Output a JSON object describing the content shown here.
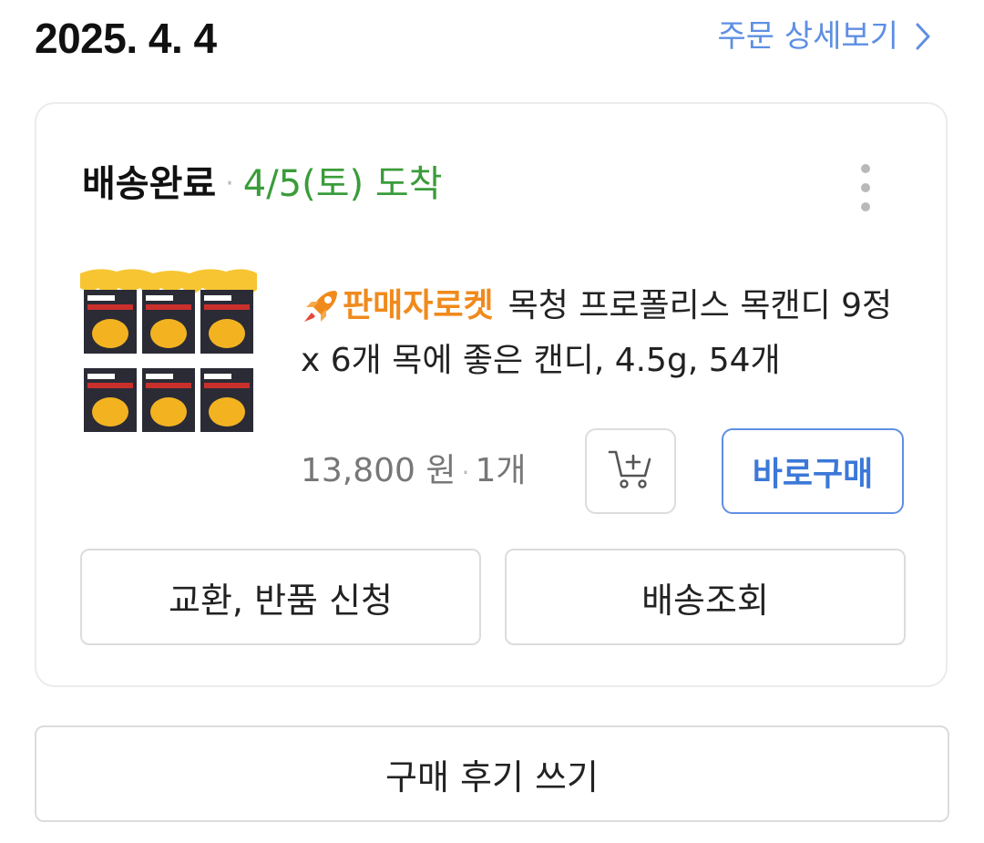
{
  "order": {
    "date": "2025. 4. 4",
    "detail_link_label": "주문 상세보기"
  },
  "card": {
    "status": "배송완료",
    "separator": "·",
    "arrival": "4/5(토) 도착"
  },
  "product": {
    "badge": "판매자로켓",
    "title": "목청 프로폴리스 목캔디 9정 x 6개 목에 좋은 캔디, 4.5g, 54개",
    "price": "13,800 원",
    "price_separator": "·",
    "quantity": "1개"
  },
  "buttons": {
    "buy_now": "바로구매",
    "exchange_return": "교환, 반품 신청",
    "track_delivery": "배송조회",
    "write_review": "구매 후기 쓰기"
  },
  "icons": {
    "detail_link": "chevron-right-icon",
    "more": "more-vertical-icon",
    "badge": "rocket-icon",
    "cart": "add-to-cart-icon"
  },
  "colors": {
    "link_blue": "#5e8fe3",
    "arrival_green": "#3a9c3a",
    "badge_orange": "#f08a1c"
  }
}
